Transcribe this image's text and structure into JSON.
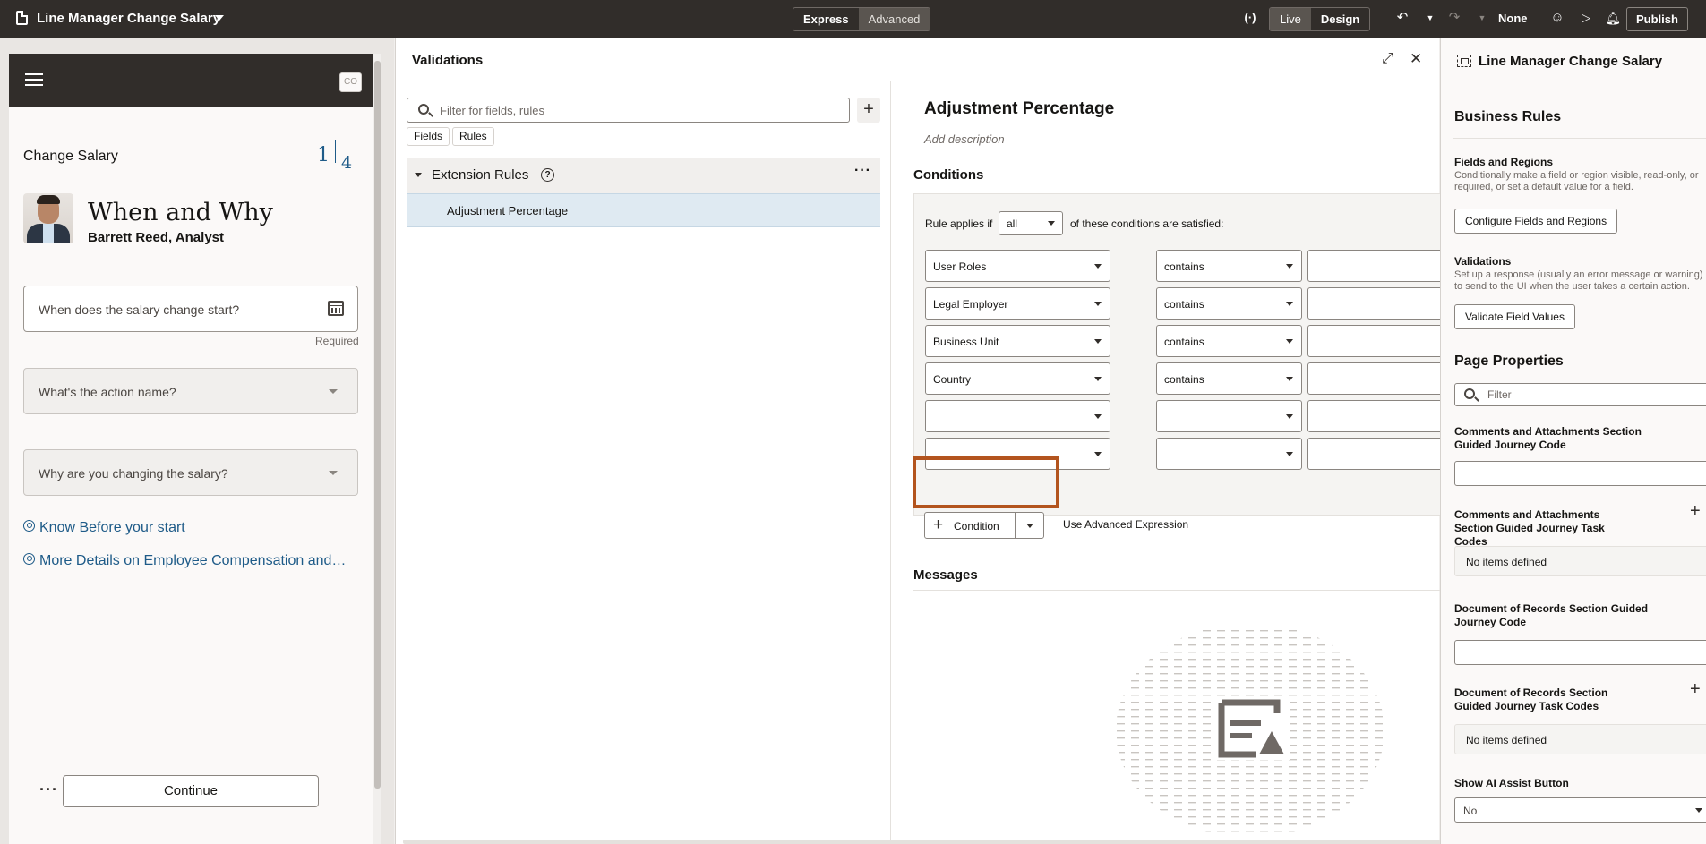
{
  "app": {
    "title": "Line Manager Change Salary"
  },
  "toolbar": {
    "mode_express": "Express",
    "mode_advanced": "Advanced",
    "view_live": "Live",
    "view_design": "Design",
    "diff_label": "None",
    "publish": "Publish"
  },
  "preview": {
    "avatar_initials": "CO",
    "page_title": "Change Salary",
    "step_current": "1",
    "step_total": "4",
    "heading": "When and Why",
    "subheading": "Barrett Reed, Analyst",
    "date_placeholder": "When does the salary change start?",
    "required_label": "Required",
    "action_name_label": "What's the action name?",
    "reason_label": "Why are you changing the salary?",
    "link1": "Know Before your start",
    "link2": "More Details on Employee Compensation and…",
    "continue": "Continue",
    "more": "···"
  },
  "validations": {
    "title": "Validations",
    "filter_placeholder": "Filter for fields, rules",
    "chip_fields": "Fields",
    "chip_rules": "Rules",
    "tree_group": "Extension Rules",
    "tree_item": "Adjustment Percentage",
    "more": "···",
    "rule": {
      "title": "Adjustment Percentage",
      "description": "Add description",
      "conditions_heading": "Conditions",
      "applies_prefix": "Rule applies if",
      "applies_value": "all",
      "applies_suffix": "of these conditions are satisfied:",
      "rows": [
        {
          "field": "User Roles",
          "operator": "contains"
        },
        {
          "field": "Legal Employer",
          "operator": "contains"
        },
        {
          "field": "Business Unit",
          "operator": "contains"
        },
        {
          "field": "Country",
          "operator": "contains"
        },
        {
          "field": "",
          "operator": ""
        },
        {
          "field": "",
          "operator": ""
        }
      ],
      "add_condition": "Condition",
      "advanced_expression": "Use Advanced Expression",
      "messages_heading": "Messages"
    }
  },
  "properties": {
    "title": "Line Manager Change Salary",
    "business_rules": "Business Rules",
    "fields_regions_title": "Fields and Regions",
    "fields_regions_desc": "Conditionally make a field or region visible, read-only, or required, or set a default value for a field.",
    "configure_btn": "Configure Fields and Regions",
    "validations_title": "Validations",
    "validations_desc": "Set up a response (usually an error message or warning) to send to the UI when the user takes a certain action.",
    "validate_btn": "Validate Field Values",
    "page_properties": "Page Properties",
    "filter_placeholder": "Filter",
    "prop1_label": "Comments and Attachments Section Guided Journey Code",
    "prop2_label": "Comments and Attachments Section Guided Journey Task Codes",
    "prop2_empty": "No items defined",
    "prop3_label": "Document of Records Section Guided Journey Code",
    "prop4_label": "Document of Records Section Guided Journey Task Codes",
    "prop4_empty": "No items defined",
    "prop5_label": "Show AI Assist Button",
    "prop5_value": "No"
  },
  "colors": {
    "topbar": "#312d2a",
    "link": "#1e5b88",
    "highlight": "#b3541e",
    "selected_row": "#dfeaf2"
  }
}
